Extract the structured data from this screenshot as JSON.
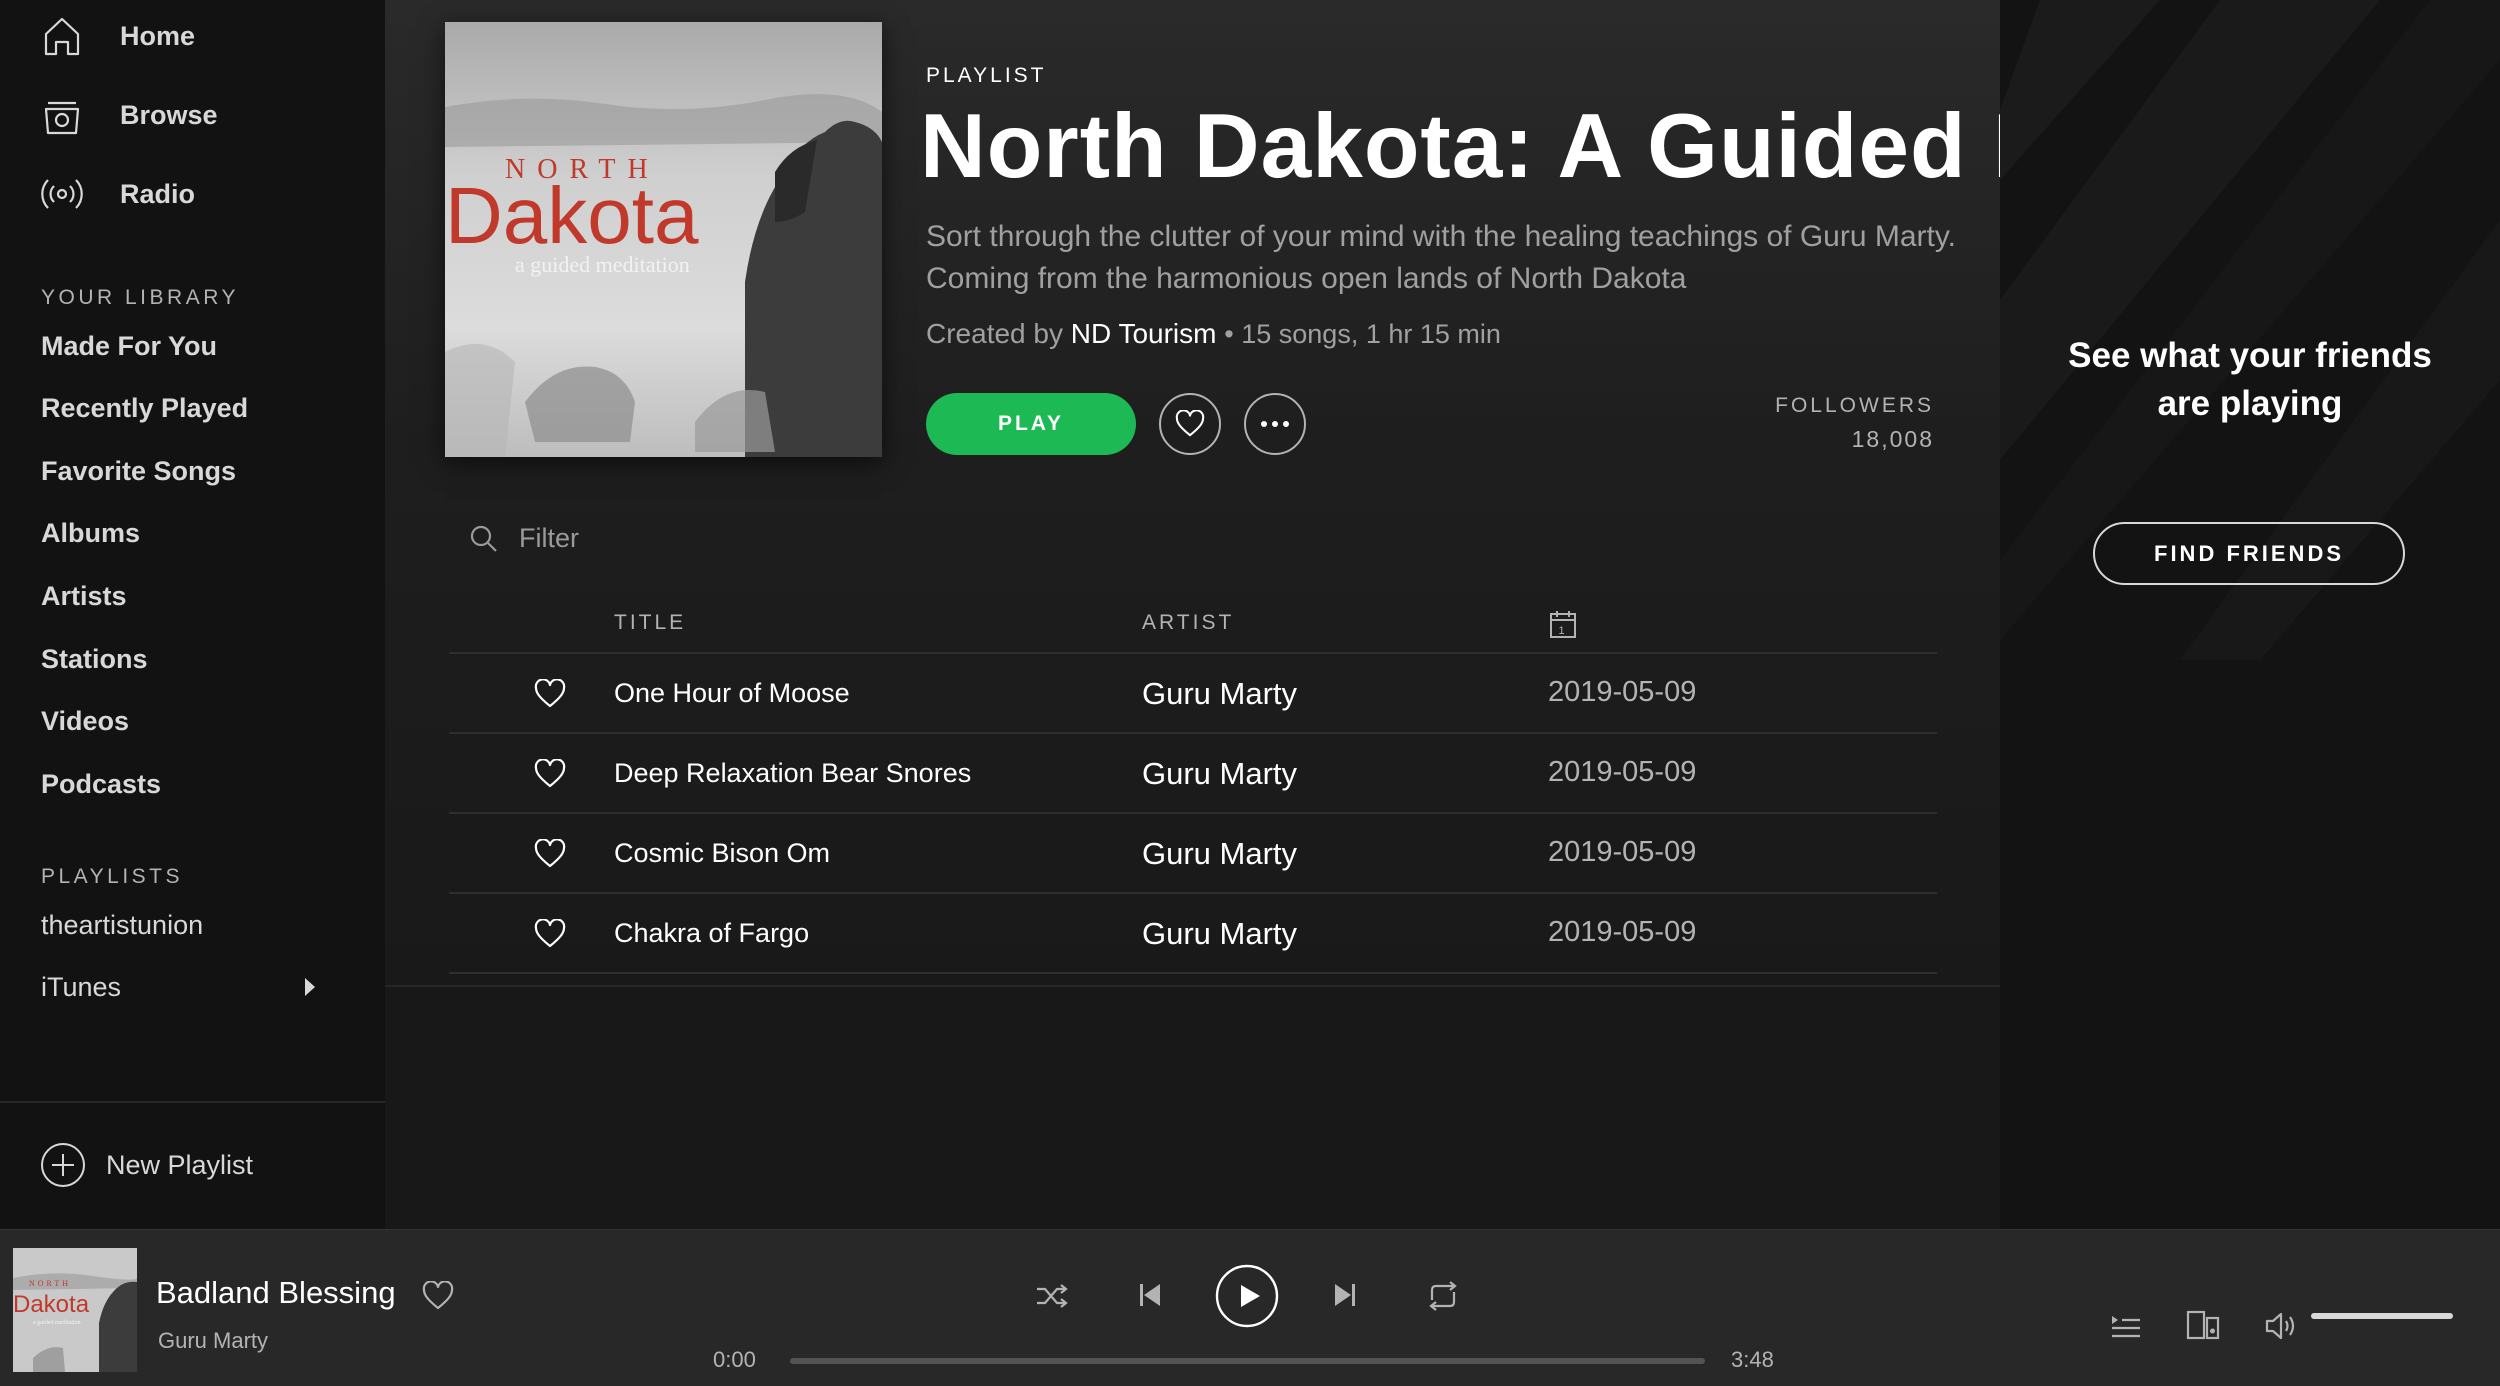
{
  "sidebar": {
    "nav": [
      {
        "label": "Home",
        "icon": "home-icon"
      },
      {
        "label": "Browse",
        "icon": "browse-icon"
      },
      {
        "label": "Radio",
        "icon": "radio-icon"
      }
    ],
    "library_heading": "YOUR LIBRARY",
    "library_items": [
      "Made For You",
      "Recently Played",
      "Favorite Songs",
      "Albums",
      "Artists",
      "Stations",
      "Videos",
      "Podcasts"
    ],
    "playlists_heading": "PLAYLISTS",
    "playlists": [
      "theartistunion",
      "iTunes"
    ],
    "new_playlist_label": "New Playlist"
  },
  "playlist": {
    "type_label": "PLAYLIST",
    "title": "North Dakota: A Guided Meditation",
    "description_line1": "Sort through the clutter of your mind with the healing teachings of Guru Marty.",
    "description_line2": "Coming from the harmonious open lands of North Dakota",
    "created_by_label": "Created by",
    "owner": "ND Tourism",
    "stats": "15 songs, 1 hr 15 min",
    "play_label": "PLAY",
    "followers_label": "FOLLOWERS",
    "followers_count": "18,008",
    "cover": {
      "line1": "NORTH",
      "line2": "Dakota",
      "line3": "a guided meditation",
      "title_color": "#c0392b"
    },
    "accent_color": "#1db954"
  },
  "filter": {
    "placeholder": "Filter"
  },
  "columns": {
    "title": "TITLE",
    "artist": "ARTIST",
    "date_icon": "calendar-icon"
  },
  "tracks": [
    {
      "title": "One Hour of Moose",
      "artist": "Guru Marty",
      "added": "2019-05-09"
    },
    {
      "title": "Deep Relaxation Bear Snores",
      "artist": "Guru Marty",
      "added": "2019-05-09"
    },
    {
      "title": "Cosmic Bison Om",
      "artist": "Guru Marty",
      "added": "2019-05-09"
    },
    {
      "title": "Chakra of Fargo",
      "artist": "Guru Marty",
      "added": "2019-05-09"
    }
  ],
  "friends": {
    "title_line1": "See what your friends",
    "title_line2": "are playing",
    "button_label": "FIND FRIENDS"
  },
  "player": {
    "title": "Badland Blessing",
    "artist": "Guru Marty",
    "time_current": "0:00",
    "time_total": "3:48",
    "progress": 0.0,
    "volume": 1.0,
    "controls": [
      "shuffle-icon",
      "previous-icon",
      "play-icon",
      "next-icon",
      "repeat-icon",
      "queue-icon",
      "devices-icon",
      "volume-icon"
    ]
  }
}
